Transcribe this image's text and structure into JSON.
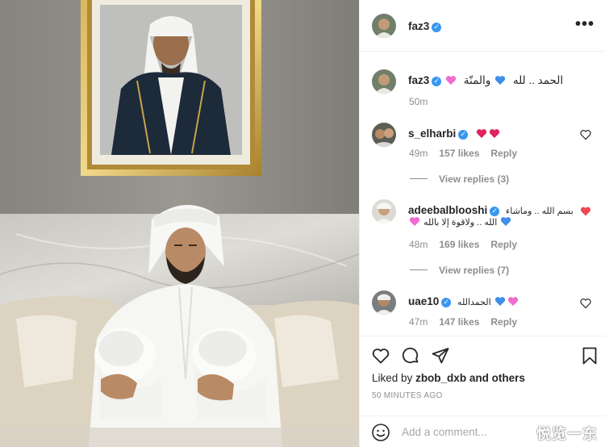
{
  "post": {
    "username": "faz3",
    "verified_mark": "✓",
    "more_icon": "more-horizontal-icon",
    "caption": {
      "username": "faz3",
      "text_arabic": "والمنّة",
      "text_arabic_2": "الحمد .. لله",
      "emoji": [
        "pink-heart",
        "blue-heart"
      ],
      "time": "50m"
    }
  },
  "comments": [
    {
      "username": "s_elharbi",
      "text": "",
      "emoji": [
        "red-heart",
        "red-heart"
      ],
      "time": "49m",
      "likes": "157 likes",
      "reply": "Reply",
      "view_replies": "View replies (3)",
      "liked": false
    },
    {
      "username": "adeebalblooshi",
      "text": "بسم الله .. وماشاء",
      "text_line2": "الله .. ولاقوة إلا بالله",
      "emoji": [
        "pink-heart",
        "blue-heart"
      ],
      "time": "48m",
      "likes": "169 likes",
      "reply": "Reply",
      "view_replies": "View replies (7)",
      "liked": true
    },
    {
      "username": "uae10",
      "text": "الحمدالله",
      "emoji": [
        "blue-heart",
        "pink-heart"
      ],
      "time": "47m",
      "likes": "147 likes",
      "reply": "Reply",
      "liked": false
    }
  ],
  "actions": {
    "icons": [
      "heart-icon",
      "comment-icon",
      "share-icon",
      "bookmark-icon"
    ],
    "liked_by_prefix": "Liked by",
    "liked_by_user": "zbob_dxb",
    "liked_by_suffix": "and others",
    "timestamp": "50 MINUTES AGO"
  },
  "add_comment": {
    "placeholder": "Add a comment...",
    "icon": "smile-icon"
  },
  "watermark": "悦览一东",
  "colors": {
    "verified": "#3897f0",
    "muted": "#8e8e8e",
    "like_red": "#ed4956",
    "pink_heart": "#f06ccf",
    "blue_heart": "#3f8fe8",
    "red_heart": "#e0245e"
  }
}
